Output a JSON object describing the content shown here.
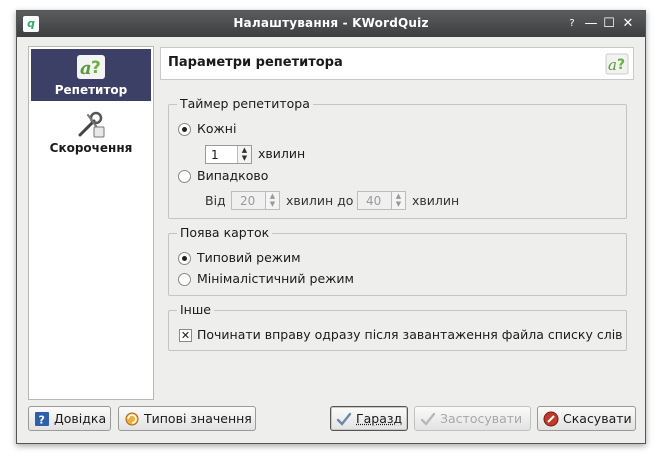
{
  "window": {
    "title": "Налаштування - KWordQuiz",
    "controls": {
      "help": "?",
      "minimize": "—",
      "maximize": "☐",
      "close": "✕"
    }
  },
  "sidebar": {
    "items": [
      {
        "label": "Репетитор",
        "icon": "quiz-icon",
        "active": true
      },
      {
        "label": "Скорочення",
        "icon": "shortcuts-icon",
        "active": false
      }
    ]
  },
  "page": {
    "title": "Параметри репетитора"
  },
  "timer": {
    "legend": "Таймер репетитора",
    "every_label": "Кожні",
    "every_value": "1",
    "minutes_label": "хвилин",
    "random_label": "Випадково",
    "from_label": "Від",
    "from_value": "20",
    "to_label": "хвилин до",
    "to_value": "40",
    "minutes_label2": "хвилин"
  },
  "cards": {
    "legend": "Поява карток",
    "mode_standard": "Типовий режим",
    "mode_minimal": "Мінімалістичний режим"
  },
  "other": {
    "legend": "Інше",
    "start_label": "Починати вправу одразу після завантаження файла списку слів",
    "start_checked": true
  },
  "buttons": {
    "help": "Довідка",
    "defaults": "Типові значення",
    "ok": "Гаразд",
    "apply": "Застосувати",
    "cancel": "Скасувати"
  }
}
